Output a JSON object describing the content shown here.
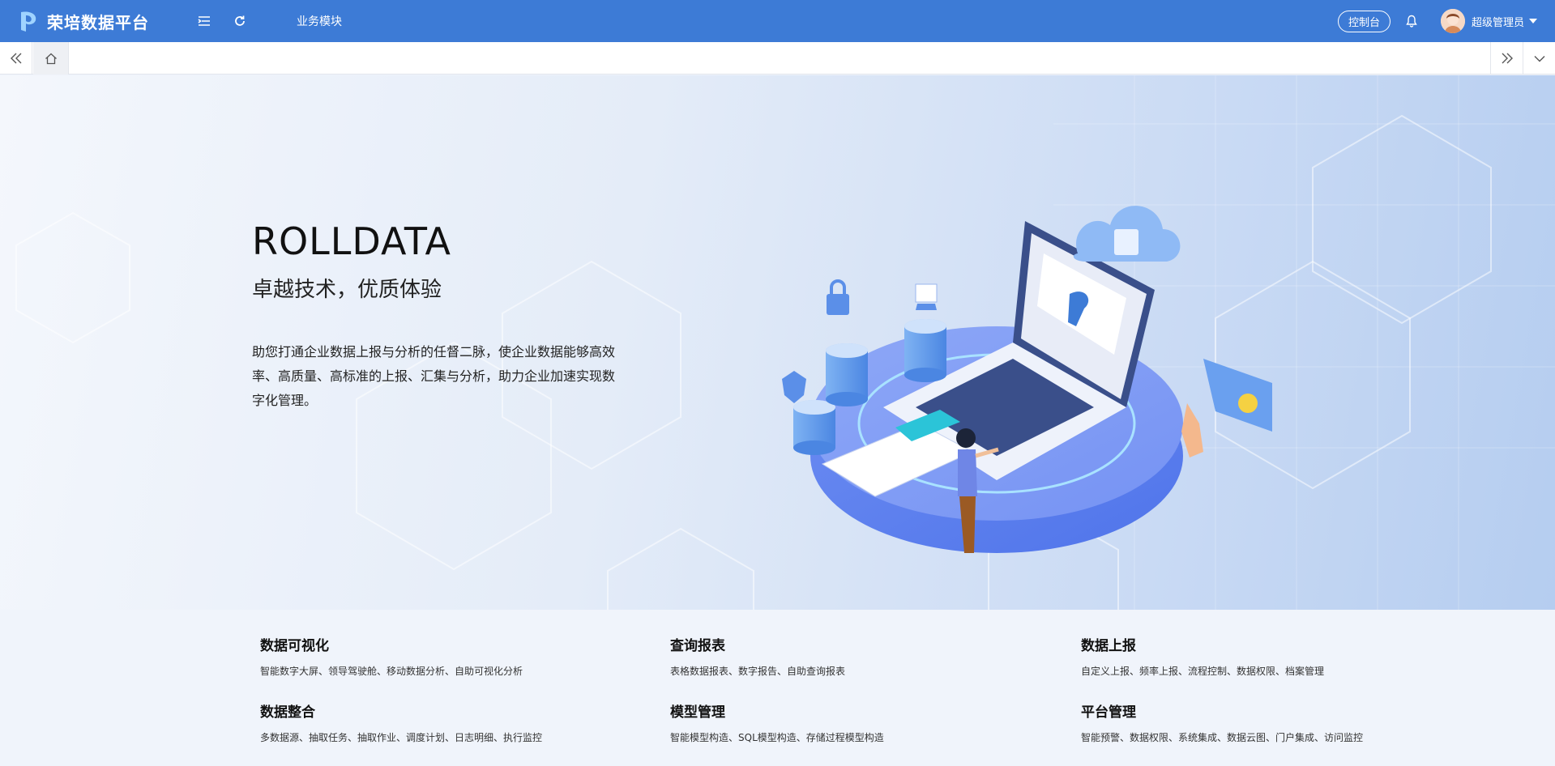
{
  "header": {
    "app_name": "荣培数据平台",
    "module_nav": "业务模块",
    "console_label": "控制台",
    "user_name": "超级管理员",
    "accent_color": "#3d7bd6"
  },
  "hero": {
    "title": "ROLLDATA",
    "subtitle": "卓越技术，优质体验",
    "description": "助您打通企业数据上报与分析的任督二脉，使企业数据能够高效率、高质量、高标准的上报、汇集与分析，助力企业加速实现数字化管理。"
  },
  "features": [
    {
      "title": "数据可视化",
      "desc": "智能数字大屏、领导驾驶舱、移动数据分析、自助可视化分析"
    },
    {
      "title": "查询报表",
      "desc": "表格数据报表、数字报告、自助查询报表"
    },
    {
      "title": "数据上报",
      "desc": "自定义上报、频率上报、流程控制、数据权限、档案管理"
    },
    {
      "title": "数据整合",
      "desc": "多数据源、抽取任务、抽取作业、调度计划、日志明细、执行监控"
    },
    {
      "title": "模型管理",
      "desc": "智能模型构造、SQL模型构造、存储过程模型构造"
    },
    {
      "title": "平台管理",
      "desc": "智能预警、数据权限、系统集成、数据云图、门户集成、访问监控"
    }
  ],
  "icons": {
    "logo": "rolldata-logo-icon",
    "menu": "menu-fold-icon",
    "refresh": "refresh-icon",
    "bell": "bell-icon",
    "home": "home-icon"
  }
}
